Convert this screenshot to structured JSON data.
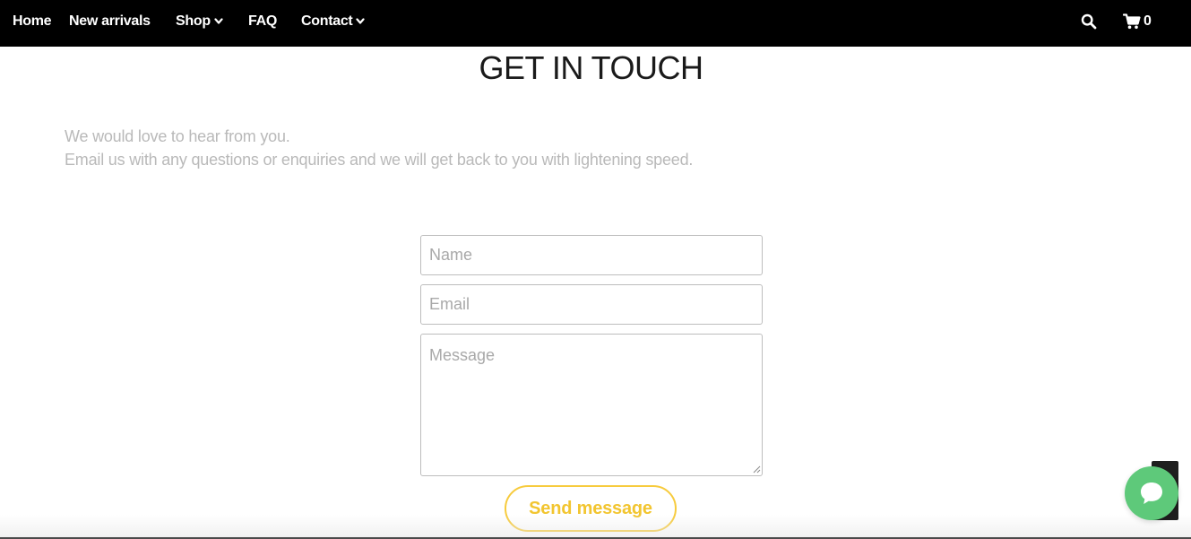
{
  "nav": {
    "home": "Home",
    "new_arrivals": "New arrivals",
    "shop": "Shop",
    "faq": "FAQ",
    "contact": "Contact",
    "cart_count": "0",
    "icons": {
      "search": "search-icon",
      "cart": "cart-icon",
      "dropdown": "chevron-down-icon"
    }
  },
  "main": {
    "title": "GET IN TOUCH",
    "intro_line1": "We would love to hear from you.",
    "intro_line2": "Email us with any questions or enquiries and we will get back to you with lightening speed."
  },
  "form": {
    "name_placeholder": "Name",
    "email_placeholder": "Email",
    "message_placeholder": "Message",
    "name_value": "",
    "email_value": "",
    "message_value": "",
    "submit_label": "Send message"
  },
  "chat_widget": {
    "icon": "chat-bubble-icon"
  },
  "colors": {
    "nav_bg": "#000000",
    "accent": "#f7cb3d",
    "chat": "#5ec97a",
    "intro_text": "#b9b9b9"
  }
}
